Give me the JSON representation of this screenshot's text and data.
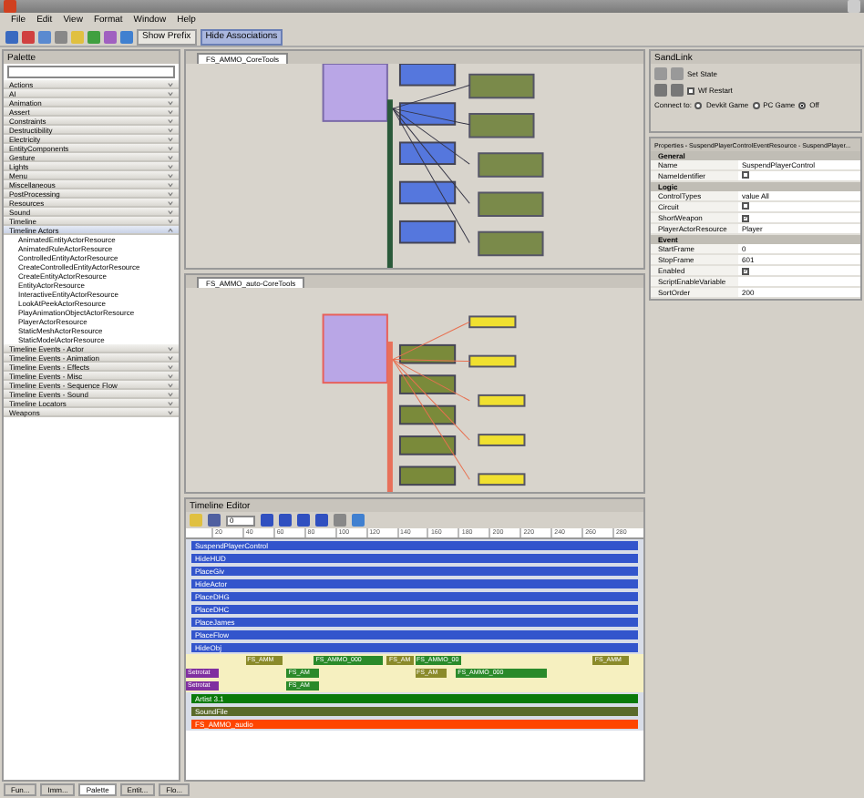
{
  "menu": [
    "File",
    "Edit",
    "View",
    "Format",
    "Window",
    "Help"
  ],
  "toolbar": {
    "buttons": [
      {
        "label": "Show Prefix",
        "selected": false
      },
      {
        "label": "Hide Associations",
        "selected": true
      }
    ]
  },
  "palette": {
    "title": "Palette",
    "categories": [
      {
        "label": "Actions",
        "expanded": false
      },
      {
        "label": "AI",
        "expanded": false
      },
      {
        "label": "Animation",
        "expanded": false
      },
      {
        "label": "Assert",
        "expanded": false
      },
      {
        "label": "Constraints",
        "expanded": false
      },
      {
        "label": "Destructibility",
        "expanded": false
      },
      {
        "label": "Electricity",
        "expanded": false
      },
      {
        "label": "EntityComponents",
        "expanded": false
      },
      {
        "label": "Gesture",
        "expanded": false
      },
      {
        "label": "Lights",
        "expanded": false
      },
      {
        "label": "Menu",
        "expanded": false
      },
      {
        "label": "Miscellaneous",
        "expanded": false
      },
      {
        "label": "PostProcessing",
        "expanded": false
      },
      {
        "label": "Resources",
        "expanded": false
      },
      {
        "label": "Sound",
        "expanded": false
      },
      {
        "label": "Timeline",
        "expanded": false
      },
      {
        "label": "Timeline Actors",
        "expanded": true,
        "children": [
          "AnimatedEntityActorResource",
          "AnimatedRuleActorResource",
          "ControlledEntityActorResource",
          "CreateControlledEntityActorResource",
          "CreateEntityActorResource",
          "EntityActorResource",
          "InteractiveEntityActorResource",
          "LookAtPeekActorResource",
          "PlayAnimationObjectActorResource",
          "PlayerActorResource",
          "StaticMeshActorResource",
          "StaticModelActorResource"
        ]
      },
      {
        "label": "Timeline Events - Actor",
        "expanded": false
      },
      {
        "label": "Timeline Events - Animation",
        "expanded": false
      },
      {
        "label": "Timeline Events - Effects",
        "expanded": false
      },
      {
        "label": "Timeline Events - Misc",
        "expanded": false
      },
      {
        "label": "Timeline Events - Sequence Flow",
        "expanded": false
      },
      {
        "label": "Timeline Events - Sound",
        "expanded": false
      },
      {
        "label": "Timeline Locators",
        "expanded": false
      },
      {
        "label": "Weapons",
        "expanded": false
      }
    ]
  },
  "graphs": [
    {
      "tab": "FS_AMMO_CoreTools"
    },
    {
      "tab": "FS_AMMO_auto-CoreTools"
    }
  ],
  "timeline": {
    "title": "Timeline Editor",
    "frame": "0",
    "ticks": [
      "20",
      "40",
      "60",
      "80",
      "100",
      "120",
      "140",
      "160",
      "180",
      "200",
      "220",
      "240",
      "260",
      "280"
    ],
    "rows": [
      {
        "kind": "bar",
        "label": "SuspendPlayerControl",
        "color": "#3355cc"
      },
      {
        "kind": "bar",
        "label": "HideHUD",
        "color": "#3355cc"
      },
      {
        "kind": "bar",
        "label": "PlaceGiv",
        "color": "#3355cc"
      },
      {
        "kind": "bar",
        "label": "HideActor",
        "color": "#3355cc"
      },
      {
        "kind": "bar",
        "label": "PlaceDHG",
        "color": "#3355cc"
      },
      {
        "kind": "bar",
        "label": "PlaceDHC",
        "color": "#3355cc"
      },
      {
        "kind": "bar",
        "label": "PlaceJames",
        "color": "#3355cc"
      },
      {
        "kind": "bar",
        "label": "PlaceFlow",
        "color": "#3355cc"
      },
      {
        "kind": "bar",
        "label": "HideObj",
        "color": "#3355cc"
      },
      {
        "kind": "clips",
        "clips": [
          "FS_AMM",
          "FS_AMMO_000",
          "FS_AM",
          "FS_AMMO_00",
          "FS_AMM"
        ]
      },
      {
        "kind": "clips",
        "clips": [
          "Setrotat",
          "FS_AM",
          "FS_AM",
          "FS_AMMO_000"
        ]
      },
      {
        "kind": "clips",
        "clips": [
          "Setrotat",
          "FS_AM"
        ]
      },
      {
        "kind": "bar",
        "label": "Artist 3.1",
        "color": "#0a7a0a"
      },
      {
        "kind": "bar",
        "label": "SoundFile",
        "color": "#5a6a2a"
      },
      {
        "kind": "bar",
        "label": "FS_AMMO_audio",
        "color": "#ff4500"
      }
    ]
  },
  "sandlink": {
    "title": "SandLink",
    "state": "Set State",
    "restart": {
      "label": "Wf Restart",
      "checked": false
    },
    "connect_label": "Connect to:",
    "targets": [
      {
        "label": "Devkit Game",
        "selected": false
      },
      {
        "label": "PC Game",
        "selected": false
      },
      {
        "label": "Off",
        "selected": true
      }
    ]
  },
  "properties": {
    "title": "Properties - SuspendPlayerControlEventResource - SuspendPlayer...",
    "sections": [
      {
        "label": "General",
        "rows": [
          {
            "kind": "text",
            "name": "Name",
            "value": "SuspendPlayerControl"
          },
          {
            "kind": "check",
            "name": "NameIdentifier",
            "checked": false
          }
        ]
      },
      {
        "label": "Logic",
        "rows": [
          {
            "kind": "types",
            "name": "ControlTypes",
            "sub": "value",
            "value": "All"
          },
          {
            "kind": "check",
            "name": "Circuit",
            "checked": false
          },
          {
            "kind": "check",
            "name": "ShortWeapon",
            "checked": true
          },
          {
            "kind": "text",
            "name": "PlayerActorResource",
            "value": "Player"
          }
        ]
      },
      {
        "label": "Event",
        "rows": [
          {
            "kind": "text",
            "name": "StartFrame",
            "value": "0"
          },
          {
            "kind": "text",
            "name": "StopFrame",
            "value": "601"
          },
          {
            "kind": "check",
            "name": "Enabled",
            "checked": true
          },
          {
            "kind": "text",
            "name": "ScriptEnableVariable",
            "value": ""
          },
          {
            "kind": "text",
            "name": "SortOrder",
            "value": "200"
          }
        ]
      }
    ]
  },
  "bottom_tabs": [
    {
      "label": "Fun...",
      "selected": false
    },
    {
      "label": "Imm...",
      "selected": false
    },
    {
      "label": "Palette",
      "selected": true
    },
    {
      "label": "Entit...",
      "selected": false
    },
    {
      "label": "Flo...",
      "selected": false
    }
  ]
}
